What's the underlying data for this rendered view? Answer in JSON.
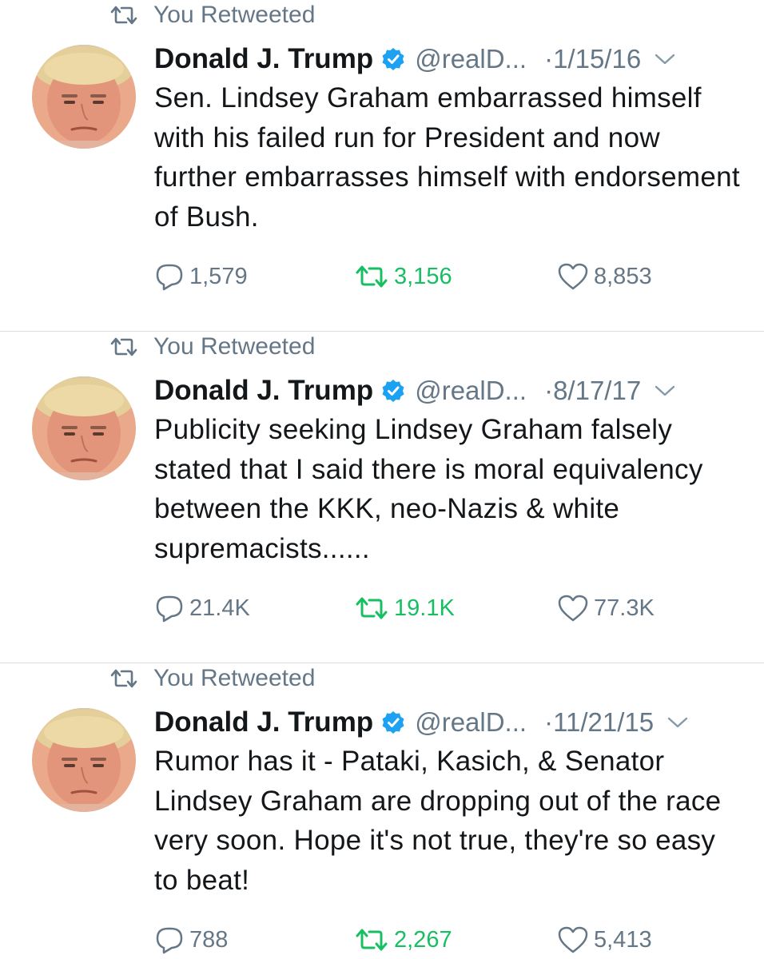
{
  "colors": {
    "text": "#14171a",
    "secondary": "#657786",
    "retweet_green": "#17bf63",
    "verified_blue": "#1da1f2",
    "divider": "#d8dde1"
  },
  "tweets": [
    {
      "retweeted_label": "You Retweeted",
      "name": "Donald J. Trump",
      "handle": "@realD...",
      "date": "·1/15/16",
      "text": "Sen. Lindsey Graham embarrassed himself with his failed run for President and now further embarrasses himself with endorsement of Bush.",
      "replies": "1,579",
      "retweets": "3,156",
      "likes": "8,853"
    },
    {
      "retweeted_label": "You Retweeted",
      "name": "Donald J. Trump",
      "handle": "@realD...",
      "date": "·8/17/17",
      "text": "Publicity seeking Lindsey Graham falsely stated that I said there is moral equivalency between the KKK, neo-Nazis & white supremacists......",
      "replies": "21.4K",
      "retweets": "19.1K",
      "likes": "77.3K"
    },
    {
      "retweeted_label": "You Retweeted",
      "name": "Donald J. Trump",
      "handle": "@realD...",
      "date": "·11/21/15",
      "text": "Rumor has it - Pataki, Kasich, & Senator Lindsey Graham are dropping out of the race very soon. Hope it's not true, they're so easy to beat!",
      "replies": "788",
      "retweets": "2,267",
      "likes": "5,413"
    }
  ]
}
